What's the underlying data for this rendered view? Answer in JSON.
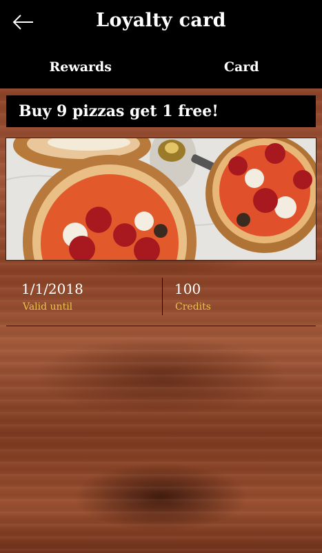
{
  "header": {
    "title": "Loyalty card",
    "back_icon": "arrow-left-icon"
  },
  "tabs": [
    {
      "label": "Rewards"
    },
    {
      "label": "Card"
    }
  ],
  "promo": {
    "text": "Buy 9 pizzas get 1 free!"
  },
  "card_info": {
    "valid_until": {
      "value": "1/1/2018",
      "label": "Valid until"
    },
    "credits": {
      "value": "100",
      "label": "Credits"
    }
  },
  "colors": {
    "header_bg": "#000000",
    "label_accent": "#e8c44a",
    "wood": "#8b4328"
  }
}
